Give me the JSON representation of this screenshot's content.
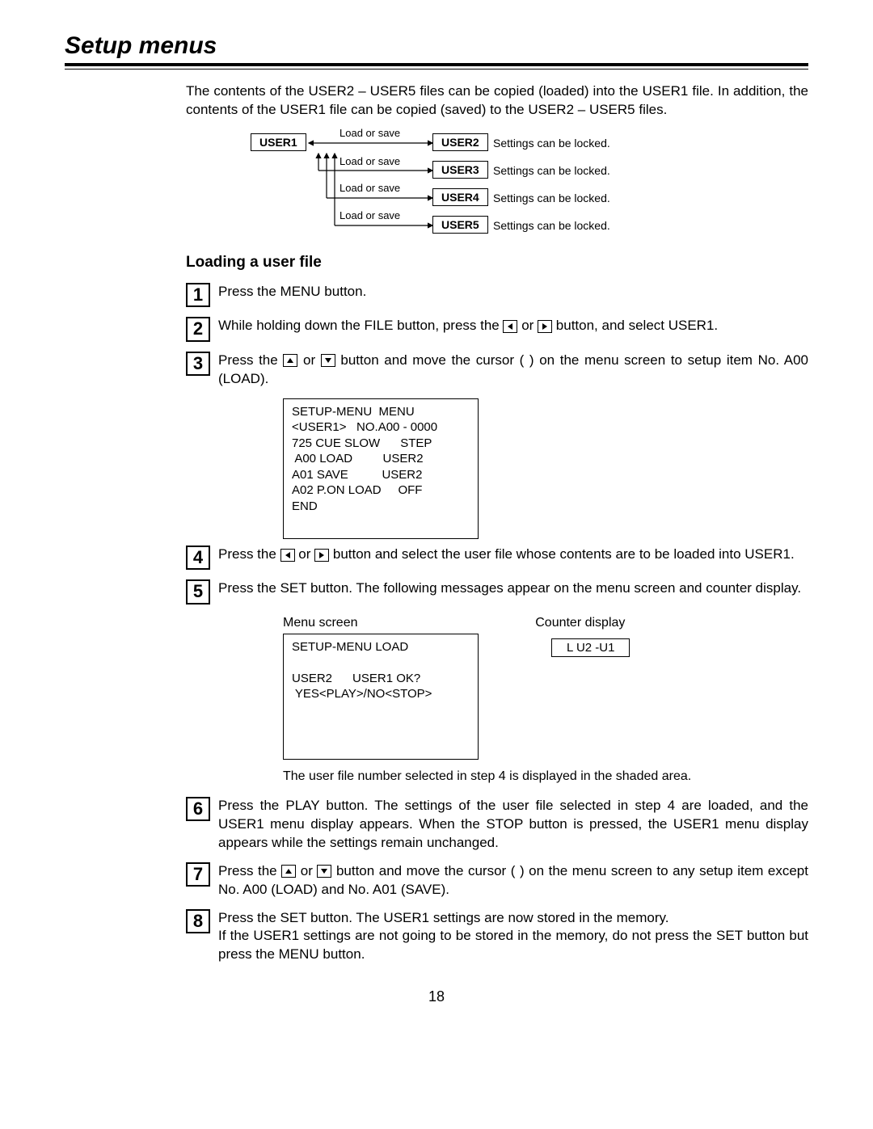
{
  "title": "Setup menus",
  "intro": "The contents of the USER2 – USER5 files can be copied (loaded) into the USER1 file. In addition, the contents of the USER1 file can be copied (saved) to the USER2 – USER5 files.",
  "diagram": {
    "user1": "USER1",
    "user2": "USER2",
    "user3": "USER3",
    "user4": "USER4",
    "user5": "USER5",
    "load_or_save": "Load or save",
    "locked": "Settings can be locked."
  },
  "subheading": "Loading a user file",
  "steps": {
    "s1": "Press the MENU button.",
    "s2a": "While holding down the FILE button, press the ",
    "s2b": " or ",
    "s2c": " button, and select USER1.",
    "s3a": "Press the ",
    "s3b": " or ",
    "s3c": " button and move the cursor (  ) on the menu screen to setup item No. A00 (LOAD).",
    "s4a": "Press the ",
    "s4b": " or ",
    "s4c": " button and select the user file whose contents are to be loaded into USER1.",
    "s5": "Press the SET button. The following messages appear on the menu screen and counter display.",
    "s6": "Press the PLAY button. The settings of the user file selected in step 4 are loaded, and the USER1 menu display appears. When the STOP button is pressed, the USER1 menu display appears while the settings remain unchanged.",
    "s7a": "Press the ",
    "s7b": " or ",
    "s7c": " button and move the cursor (  ) on the menu screen to any setup item except No. A00 (LOAD) and No. A01 (SAVE).",
    "s8": "Press the SET button. The USER1 settings are now stored in the memory.\nIf the USER1 settings are not going to be stored in the memory, do not press the SET button but press the MENU button."
  },
  "menu_screen_label": "Menu screen",
  "counter_label": "Counter display",
  "menu_box_1": "SETUP-MENU  MENU\n<USER1>   NO.A00 - 0000\n725 CUE SLOW      STEP\n A00 LOAD         USER2\nA01 SAVE          USER2\nA02 P.ON LOAD     OFF\nEND",
  "menu_box_2": "SETUP-MENU LOAD\n\nUSER2      USER1 OK?\n YES<PLAY>/NO<STOP>",
  "counter_box": "L U2 -U1",
  "footnote": "The user file number selected in step 4 is displayed in the shaded area.",
  "page_number": "18"
}
